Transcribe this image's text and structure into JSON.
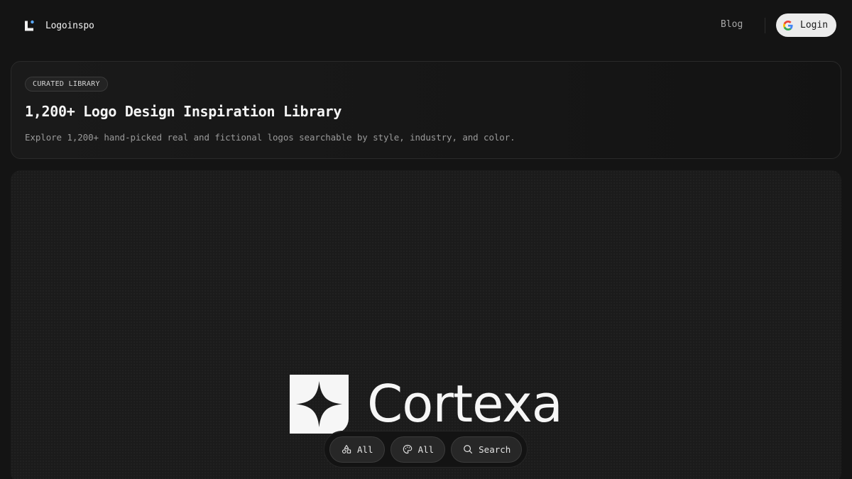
{
  "nav": {
    "brand_name": "Logoinspo",
    "brand_icon": "logoinspo-mark-icon",
    "blog_label": "Blog",
    "login_label": "Login",
    "login_icon": "google-icon"
  },
  "hero": {
    "badge": "CURATED LIBRARY",
    "title": "1,200+ Logo Design Inspiration Library",
    "subtitle": "Explore 1,200+ hand-picked real and fictional logos searchable by style, industry, and color."
  },
  "showcase": {
    "logo_word": "Cortexa",
    "logo_icon": "four-point-star-icon"
  },
  "filters": [
    {
      "label": "All",
      "icon": "shapes-icon"
    },
    {
      "label": "All",
      "icon": "palette-icon"
    },
    {
      "label": "Search",
      "icon": "search-icon"
    }
  ],
  "colors": {
    "background": "#141414",
    "panel": "#1b1b1b",
    "accent_dot": "#5aa9ff"
  }
}
